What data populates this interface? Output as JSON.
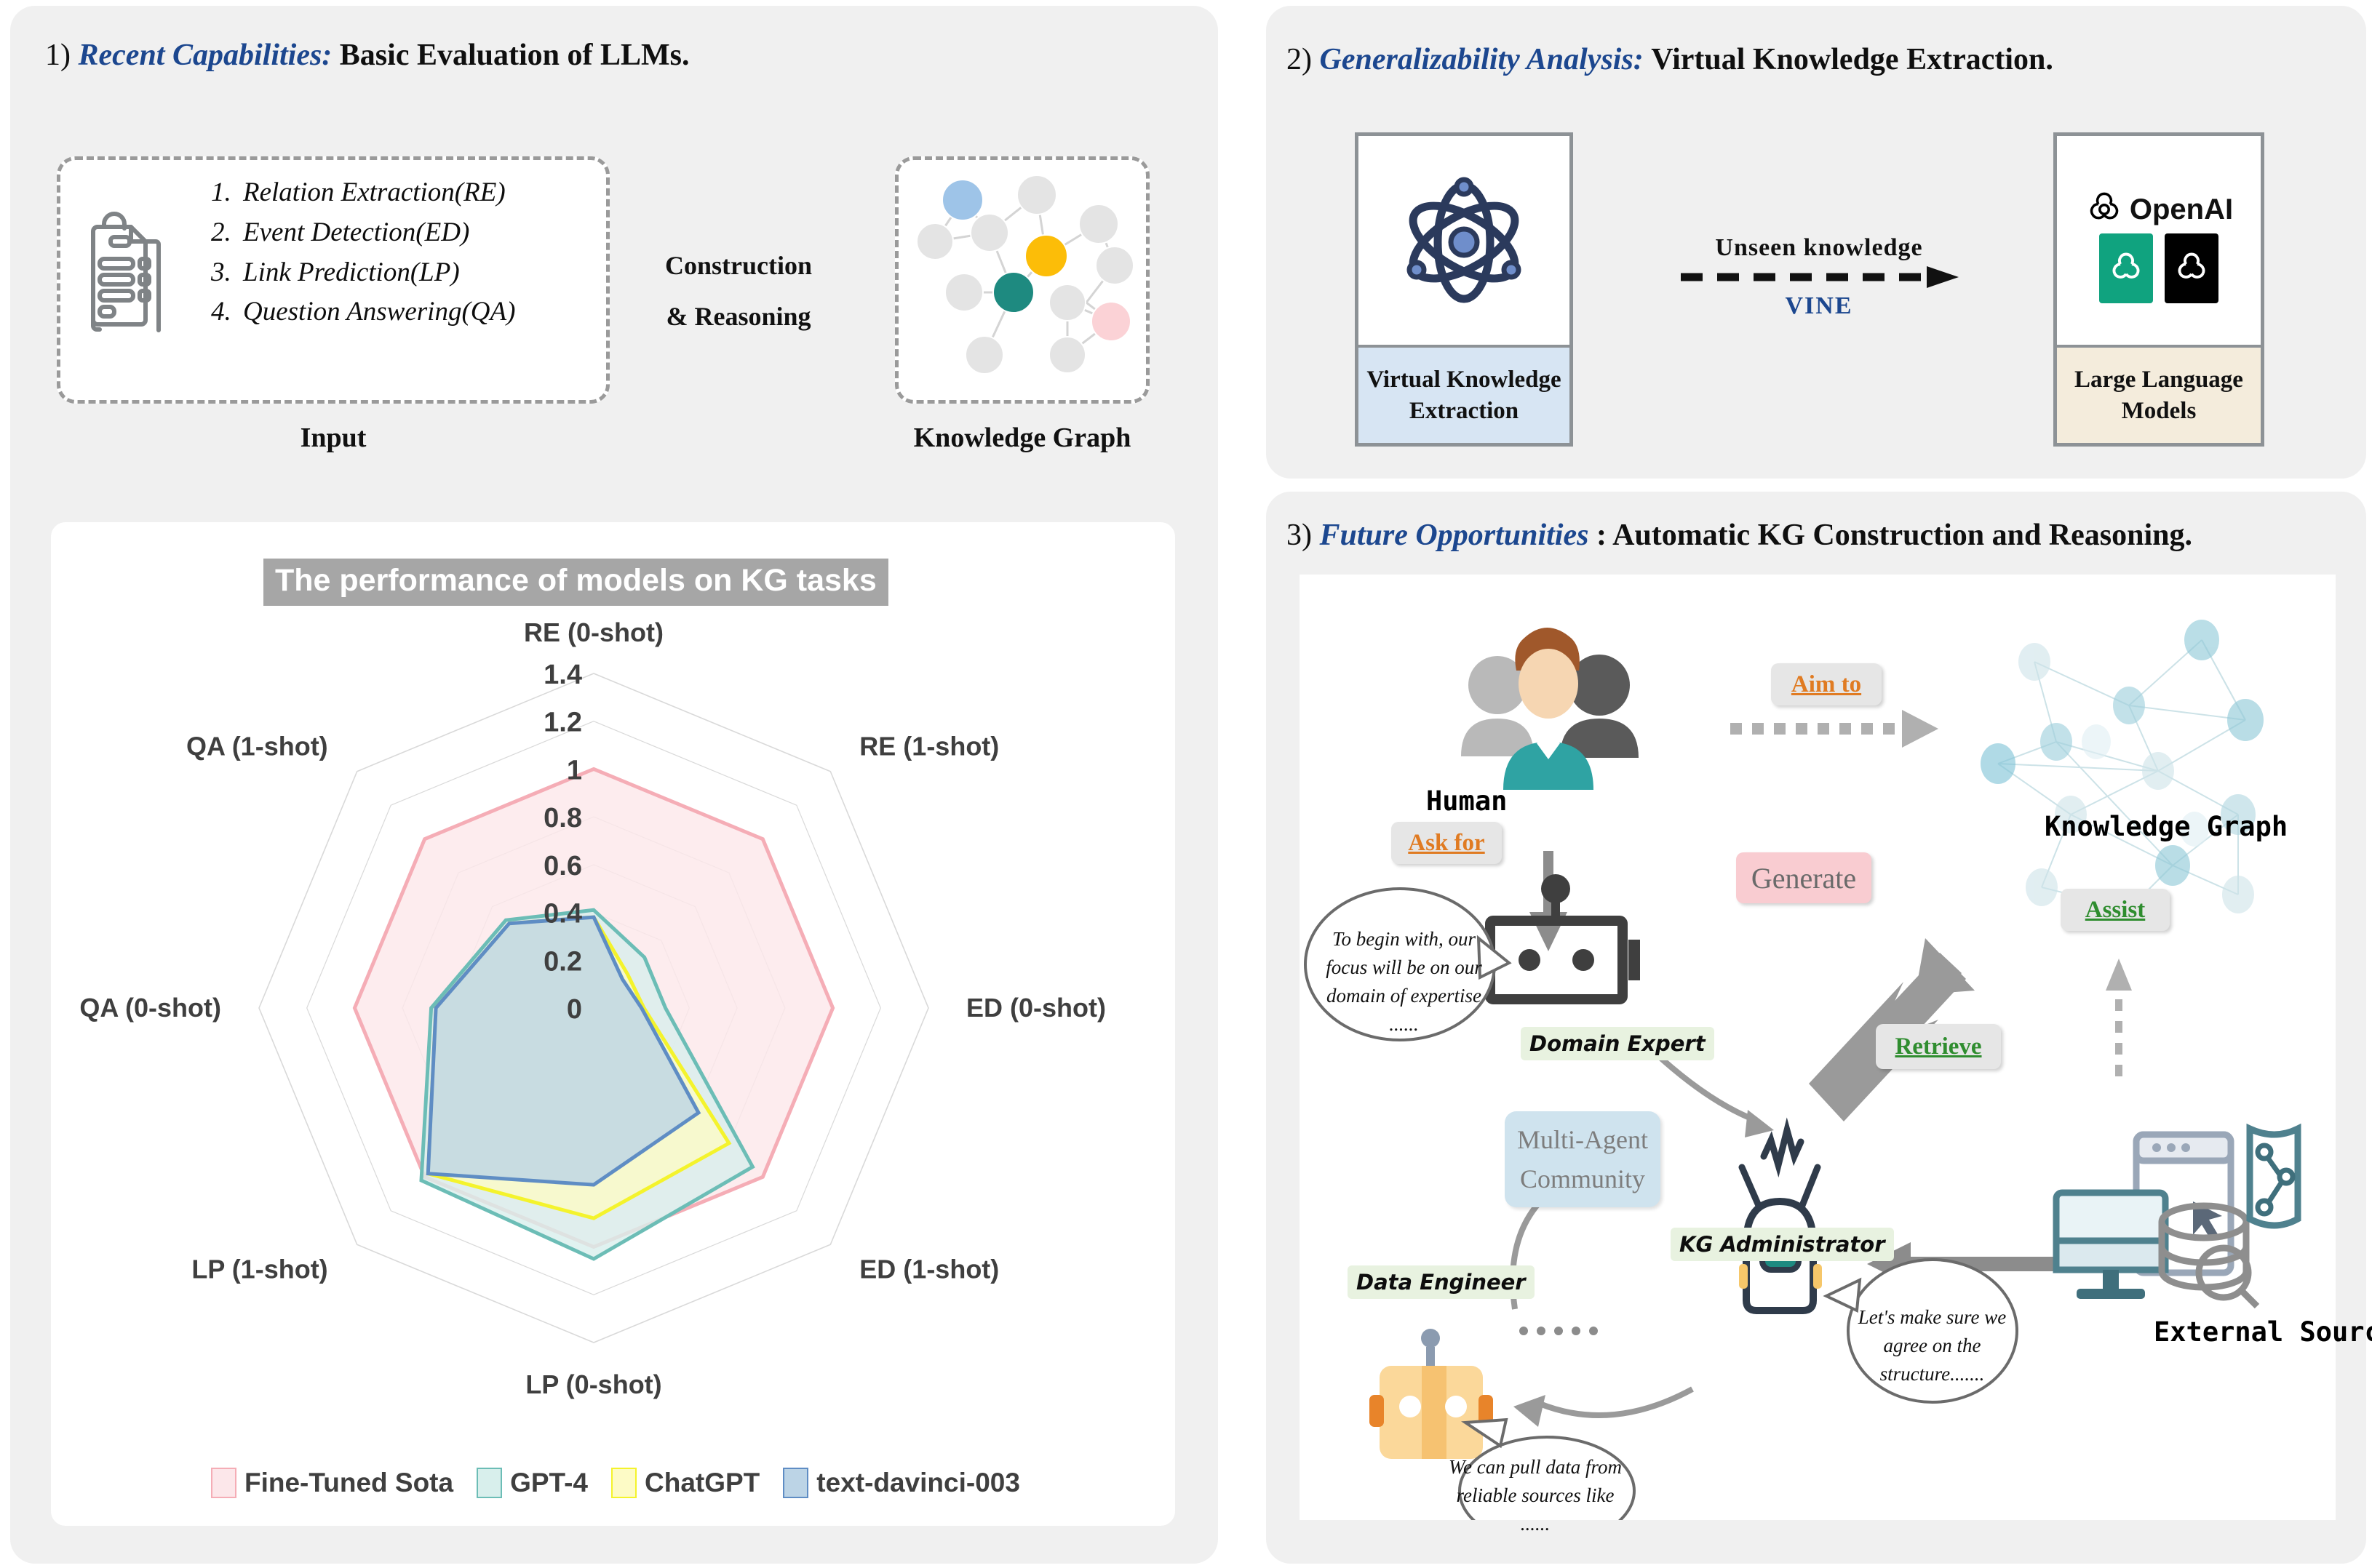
{
  "panel1": {
    "header": {
      "num": "1)",
      "emph": "Recent Capabilities:",
      "rest": "Basic Evaluation of  LLMs."
    },
    "input_label": "Input",
    "middle_label_line1": "Construction",
    "middle_label_line2": "& Reasoning",
    "kg_label": "Knowledge Graph",
    "tasks": [
      {
        "idx": "1.",
        "text": "Relation Extraction(RE)"
      },
      {
        "idx": "2.",
        "text": "Event Detection(ED)"
      },
      {
        "idx": "3.",
        "text": "Link Prediction(LP)"
      },
      {
        "idx": "4.",
        "text": "Question Answering(QA)"
      }
    ],
    "kg_node_colors": {
      "blue": "#9ec4e8",
      "yellow": "#fcbd08",
      "teal": "#1e8a80",
      "pink": "#fbd2d6",
      "gray": "#e4e4e4"
    },
    "doc_icon": "document-list-icon"
  },
  "chart_data": {
    "type": "radar",
    "title": "The performance of models on KG tasks",
    "categories": [
      "RE (0-shot)",
      "RE (1-shot)",
      "ED (0-shot)",
      "ED (1-shot)",
      "LP (0-shot)",
      "LP (1-shot)",
      "QA (0-shot)",
      "QA (1-shot)"
    ],
    "tick_labels": [
      "0",
      "0.2",
      "0.4",
      "0.6",
      "0.8",
      "1",
      "1.2",
      "1.4"
    ],
    "rlim": [
      0,
      1.4
    ],
    "rstep": 0.2,
    "grid": true,
    "legend_position": "bottom",
    "series": [
      {
        "name": "Fine-Tuned Sota",
        "fill": "#fce7ea",
        "stroke": "#f5adb6",
        "values": [
          1.0,
          1.0,
          1.0,
          1.0,
          1.0,
          1.0,
          1.0,
          1.0
        ]
      },
      {
        "name": "GPT-4",
        "fill": "#d8efec",
        "stroke": "#6cbdb6",
        "values": [
          0.41,
          0.3,
          0.3,
          0.94,
          1.05,
          1.02,
          0.68,
          0.52
        ]
      },
      {
        "name": "ChatGPT",
        "fill": "#fdfbc6",
        "stroke": "#f4f32c",
        "values": [
          0.38,
          0.2,
          0.21,
          0.8,
          0.88,
          0.98,
          0.66,
          0.5
        ]
      },
      {
        "name": "text-davinci-003",
        "fill": "#bcd4e6",
        "stroke": "#5f8dc4",
        "values": [
          0.38,
          0.17,
          0.2,
          0.62,
          0.74,
          0.98,
          0.66,
          0.5
        ]
      }
    ]
  },
  "panel2": {
    "header": {
      "num": "2)",
      "emph": "Generalizability Analysis:",
      "rest": "Virtual Knowledge Extraction."
    },
    "left_card": {
      "icon": "atom-icon",
      "caption_line1": "Virtual Knowledge",
      "caption_line2": "Extraction",
      "caption_bg": "#d7e5f3"
    },
    "right_card": {
      "icon": "openai-logo-icon",
      "brand": "OpenAI",
      "caption_line1": "Large Language",
      "caption_line2": "Models",
      "caption_bg": "#f4ecdc",
      "logo_green": "#10a37f",
      "logo_black": "#000000"
    },
    "arrow": {
      "top_label": "Unseen  knowledge",
      "bottom_label": "VINE",
      "style": "dashed-arrow-right",
      "bottom_color": "#1c478f"
    }
  },
  "panel3": {
    "header": {
      "num": "3)",
      "emph": "Future Opportunities",
      "rest": ": Automatic KG Construction and Reasoning."
    },
    "human_label": "Human",
    "kg_label": "Knowledge Graph",
    "external_label": "External Sources",
    "tags": {
      "aim_to": "Aim to",
      "ask_for": "Ask for",
      "generate": "Generate",
      "assist": "Assist",
      "retrieve": "Retrieve"
    },
    "community": {
      "line1": "Multi-Agent",
      "line2": "Community"
    },
    "roles": [
      {
        "name": "Domain Expert",
        "icon": "robot-head-icon"
      },
      {
        "name": "KG Administrator",
        "icon": "robot-antenna-icon"
      },
      {
        "name": "Data Engineer",
        "icon": "robot-orange-icon"
      }
    ],
    "bubbles": [
      {
        "speaker": "Domain Expert",
        "text": "To begin with, our focus will be on our domain of expertise ......"
      },
      {
        "speaker": "KG Administrator",
        "text": "Let's make sure we agree on the structure......."
      },
      {
        "speaker": "Data Engineer",
        "text": "We can pull data from reliable sources like ......"
      }
    ],
    "dots": "......",
    "accent_colors": {
      "orange": "#e07b22",
      "green": "#2f8d2f",
      "pink": "#f9ccd1",
      "blue": "#cfe3ee"
    }
  }
}
